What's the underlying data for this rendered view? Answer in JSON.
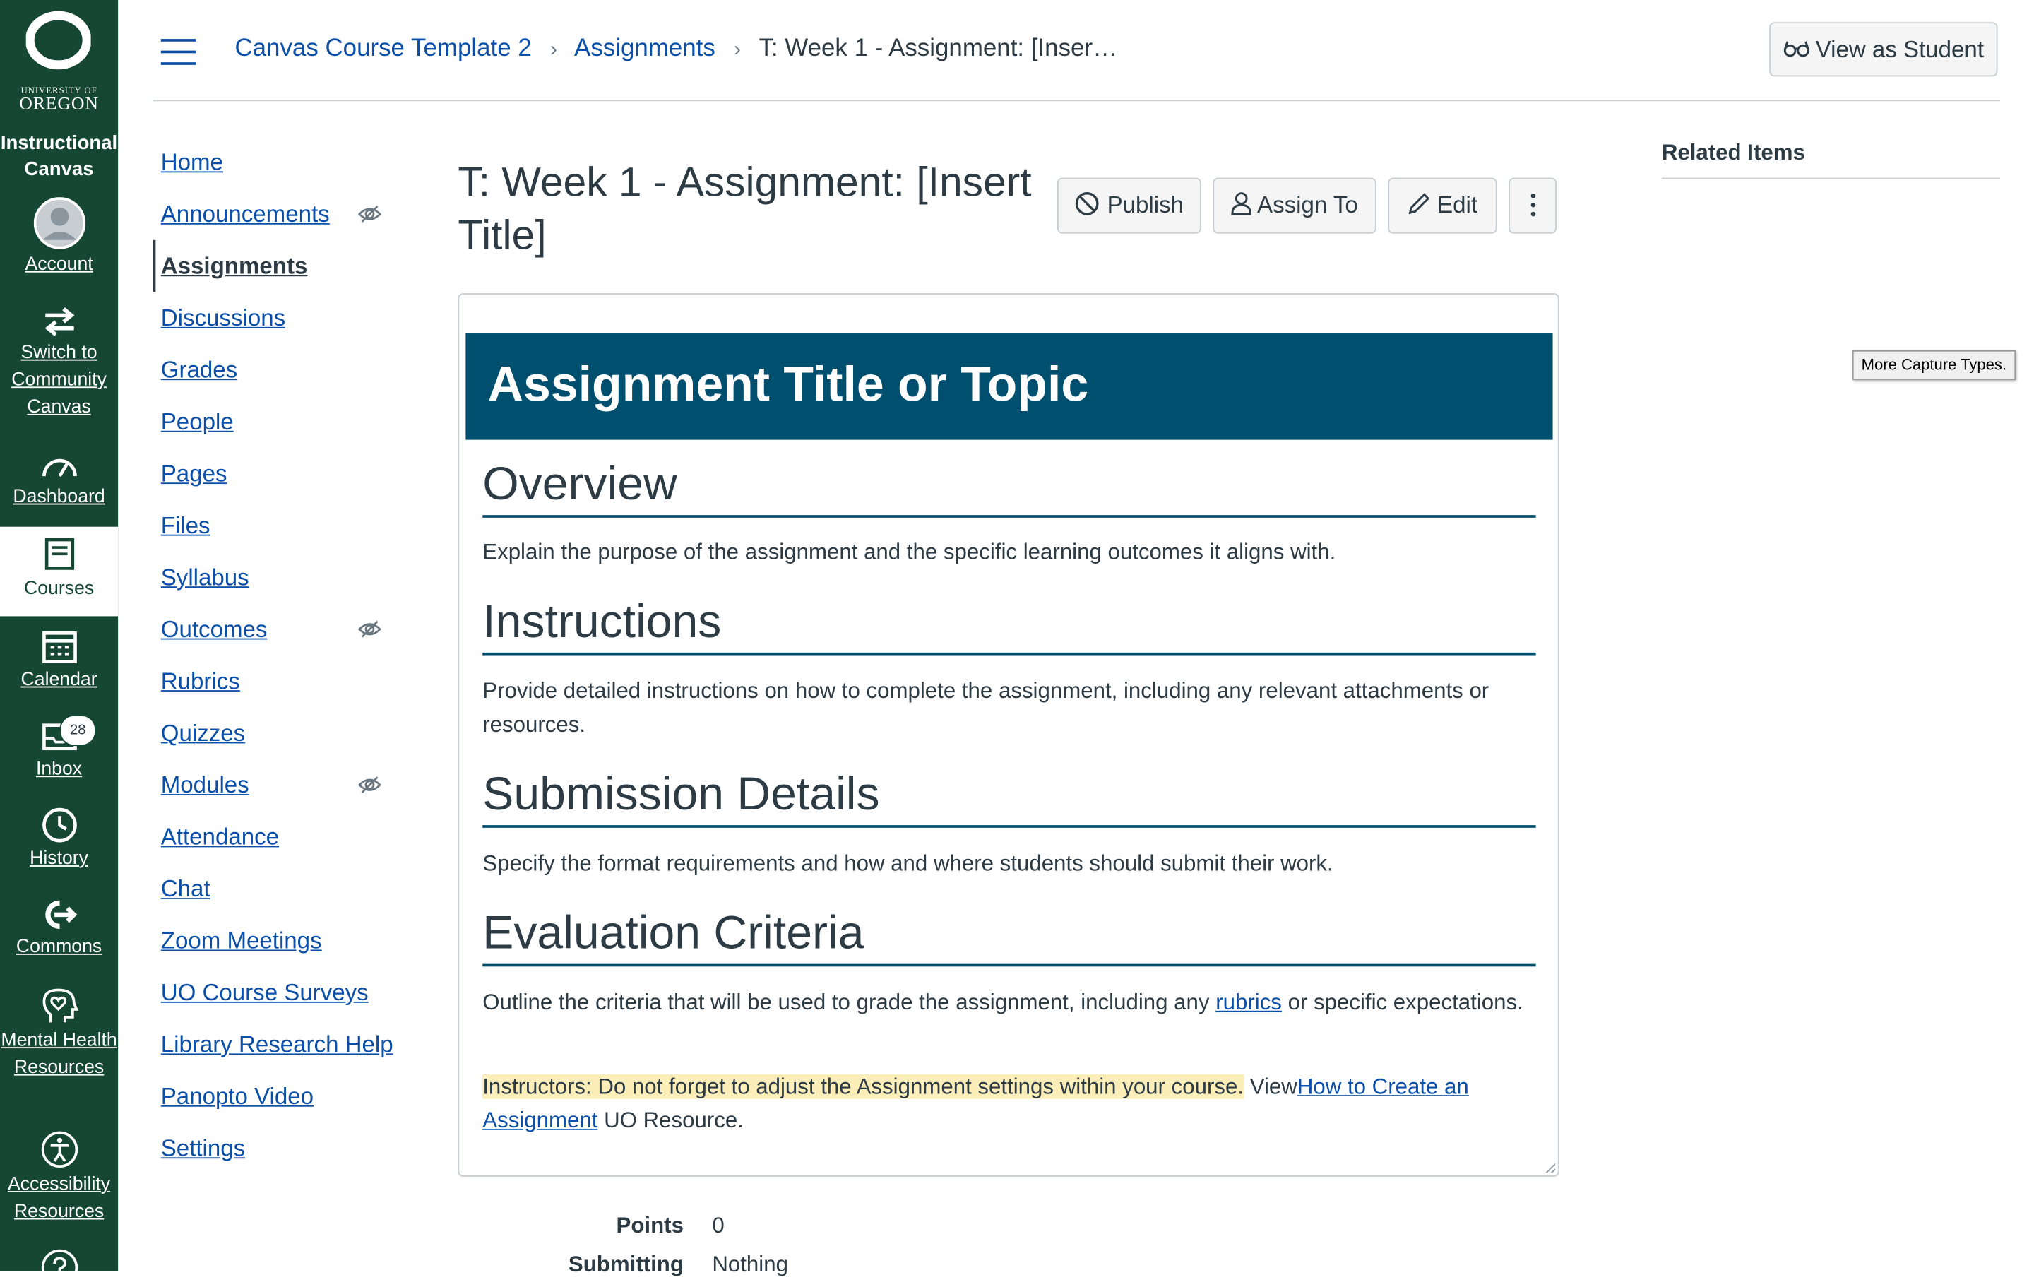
{
  "global_nav": {
    "logo_top": "UNIVERSITY OF",
    "logo_bottom": "OREGON",
    "instance_label": "Instructional Canvas",
    "items": [
      {
        "label": "Account",
        "icon": "avatar-icon"
      },
      {
        "label": "Switch to Community Canvas",
        "icon": "switch-arrows-icon"
      },
      {
        "label": "Dashboard",
        "icon": "dashboard-gauge-icon"
      },
      {
        "label": "Courses",
        "icon": "book-icon",
        "active": true
      },
      {
        "label": "Calendar",
        "icon": "calendar-icon"
      },
      {
        "label": "Inbox",
        "icon": "inbox-icon",
        "badge": "28"
      },
      {
        "label": "History",
        "icon": "clock-icon"
      },
      {
        "label": "Commons",
        "icon": "commons-arrow-icon"
      },
      {
        "label": "Mental Health Resources",
        "icon": "heart-head-icon"
      },
      {
        "label": "Accessibility Resources",
        "icon": "accessibility-icon"
      }
    ]
  },
  "header": {
    "breadcrumb": [
      "Canvas Course Template 2",
      "Assignments",
      "T: Week 1 - Assignment: [Inser…"
    ],
    "view_as_student": "View as Student"
  },
  "course_nav": {
    "items": [
      "Home",
      "Announcements",
      "Assignments",
      "Discussions",
      "Grades",
      "People",
      "Pages",
      "Files",
      "Syllabus",
      "Outcomes",
      "Rubrics",
      "Quizzes",
      "Modules",
      "Attendance",
      "Chat",
      "Zoom Meetings",
      "UO Course Surveys",
      "Library Research Help",
      "Panopto Video",
      "Settings"
    ],
    "hidden_items": [
      "Announcements",
      "Outcomes",
      "Modules"
    ],
    "active": "Assignments"
  },
  "assignment": {
    "title": "T: Week 1 - Assignment: [Insert Title]",
    "buttons": {
      "publish": "Publish",
      "assign_to": "Assign To",
      "edit": "Edit"
    },
    "banner": "Assignment Title or Topic",
    "sections": {
      "overview_h": "Overview",
      "overview_p": "Explain the purpose of the assignment and the specific learning outcomes it aligns with.",
      "instructions_h": "Instructions",
      "instructions_p": "Provide detailed instructions on how to complete the assignment, including any relevant attachments or resources.",
      "submission_h": "Submission Details",
      "submission_p": "Specify the format requirements and how and where students should submit their work.",
      "evaluation_h": "Evaluation Criteria",
      "evaluation_p1": "Outline the criteria that will be used to grade the assignment, including any ",
      "evaluation_link": "rubrics",
      "evaluation_p2": " or specific expectations.",
      "note_highlight": "Instructors: Do not forget to adjust the Assignment settings within your course.",
      "note_view": " View",
      "note_link": "How to Create an Assignment",
      "note_tail": " UO Resource."
    },
    "details": [
      {
        "label": "Points",
        "value": "0"
      },
      {
        "label": "Submitting",
        "value": "Nothing"
      }
    ]
  },
  "sidebar": {
    "related_items": "Related Items",
    "tooltip": "More Capture Types."
  },
  "colors": {
    "nav_green": "#154734",
    "banner_blue": "#004f6e",
    "link_blue": "#0b4fa8"
  }
}
